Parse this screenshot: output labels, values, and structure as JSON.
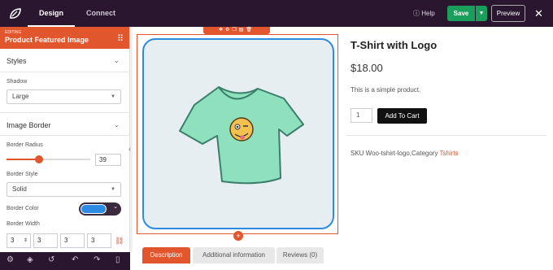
{
  "topbar": {
    "tabs": [
      {
        "label": "Design"
      },
      {
        "label": "Connect"
      }
    ],
    "help_label": "Help",
    "save_label": "Save",
    "preview_label": "Preview"
  },
  "sidebar": {
    "editing_label": "EDITING",
    "title": "Product Featured Image",
    "styles_label": "Styles",
    "shadow_label": "Shadow",
    "shadow_value": "Large",
    "image_border_label": "Image Border",
    "border_radius_label": "Border Radius",
    "border_radius_value": "39",
    "border_radius_fraction": 0.39,
    "border_style_label": "Border Style",
    "border_style_value": "Solid",
    "border_color_label": "Border Color",
    "border_color_value": "#2d8be4",
    "border_width_label": "Border Width",
    "border_width_values": [
      "3",
      "3",
      "3",
      "3"
    ]
  },
  "product": {
    "title": "T-Shirt with Logo",
    "price": "$18.00",
    "description": "This is a simple product.",
    "quantity": "1",
    "add_to_cart_label": "Add To Cart",
    "sku_text": "SKU Woo-tshirt-logo,Category",
    "category_link": "Tshirts",
    "tabs": [
      {
        "label": "Description"
      },
      {
        "label": "Additional information"
      },
      {
        "label": "Reviews (0)"
      }
    ]
  },
  "colors": {
    "accent": "#e2562d",
    "topbar": "#2b1630",
    "save": "#1a9e5b",
    "border_color": "#2d8be4"
  }
}
